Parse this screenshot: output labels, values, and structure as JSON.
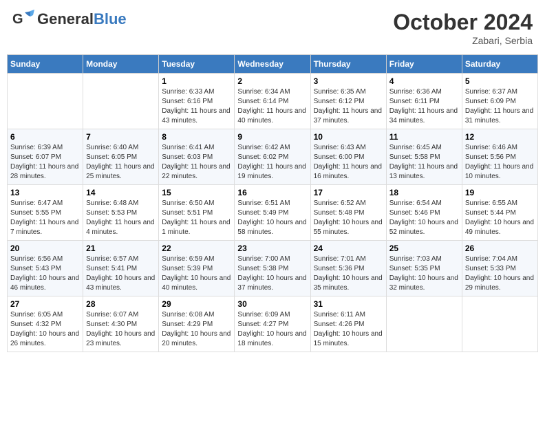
{
  "header": {
    "logo_general": "General",
    "logo_blue": "Blue",
    "month": "October 2024",
    "location": "Zabari, Serbia"
  },
  "weekdays": [
    "Sunday",
    "Monday",
    "Tuesday",
    "Wednesday",
    "Thursday",
    "Friday",
    "Saturday"
  ],
  "weeks": [
    [
      {
        "day": "",
        "info": ""
      },
      {
        "day": "",
        "info": ""
      },
      {
        "day": "1",
        "info": "Sunrise: 6:33 AM\nSunset: 6:16 PM\nDaylight: 11 hours and 43 minutes."
      },
      {
        "day": "2",
        "info": "Sunrise: 6:34 AM\nSunset: 6:14 PM\nDaylight: 11 hours and 40 minutes."
      },
      {
        "day": "3",
        "info": "Sunrise: 6:35 AM\nSunset: 6:12 PM\nDaylight: 11 hours and 37 minutes."
      },
      {
        "day": "4",
        "info": "Sunrise: 6:36 AM\nSunset: 6:11 PM\nDaylight: 11 hours and 34 minutes."
      },
      {
        "day": "5",
        "info": "Sunrise: 6:37 AM\nSunset: 6:09 PM\nDaylight: 11 hours and 31 minutes."
      }
    ],
    [
      {
        "day": "6",
        "info": "Sunrise: 6:39 AM\nSunset: 6:07 PM\nDaylight: 11 hours and 28 minutes."
      },
      {
        "day": "7",
        "info": "Sunrise: 6:40 AM\nSunset: 6:05 PM\nDaylight: 11 hours and 25 minutes."
      },
      {
        "day": "8",
        "info": "Sunrise: 6:41 AM\nSunset: 6:03 PM\nDaylight: 11 hours and 22 minutes."
      },
      {
        "day": "9",
        "info": "Sunrise: 6:42 AM\nSunset: 6:02 PM\nDaylight: 11 hours and 19 minutes."
      },
      {
        "day": "10",
        "info": "Sunrise: 6:43 AM\nSunset: 6:00 PM\nDaylight: 11 hours and 16 minutes."
      },
      {
        "day": "11",
        "info": "Sunrise: 6:45 AM\nSunset: 5:58 PM\nDaylight: 11 hours and 13 minutes."
      },
      {
        "day": "12",
        "info": "Sunrise: 6:46 AM\nSunset: 5:56 PM\nDaylight: 11 hours and 10 minutes."
      }
    ],
    [
      {
        "day": "13",
        "info": "Sunrise: 6:47 AM\nSunset: 5:55 PM\nDaylight: 11 hours and 7 minutes."
      },
      {
        "day": "14",
        "info": "Sunrise: 6:48 AM\nSunset: 5:53 PM\nDaylight: 11 hours and 4 minutes."
      },
      {
        "day": "15",
        "info": "Sunrise: 6:50 AM\nSunset: 5:51 PM\nDaylight: 11 hours and 1 minute."
      },
      {
        "day": "16",
        "info": "Sunrise: 6:51 AM\nSunset: 5:49 PM\nDaylight: 10 hours and 58 minutes."
      },
      {
        "day": "17",
        "info": "Sunrise: 6:52 AM\nSunset: 5:48 PM\nDaylight: 10 hours and 55 minutes."
      },
      {
        "day": "18",
        "info": "Sunrise: 6:54 AM\nSunset: 5:46 PM\nDaylight: 10 hours and 52 minutes."
      },
      {
        "day": "19",
        "info": "Sunrise: 6:55 AM\nSunset: 5:44 PM\nDaylight: 10 hours and 49 minutes."
      }
    ],
    [
      {
        "day": "20",
        "info": "Sunrise: 6:56 AM\nSunset: 5:43 PM\nDaylight: 10 hours and 46 minutes."
      },
      {
        "day": "21",
        "info": "Sunrise: 6:57 AM\nSunset: 5:41 PM\nDaylight: 10 hours and 43 minutes."
      },
      {
        "day": "22",
        "info": "Sunrise: 6:59 AM\nSunset: 5:39 PM\nDaylight: 10 hours and 40 minutes."
      },
      {
        "day": "23",
        "info": "Sunrise: 7:00 AM\nSunset: 5:38 PM\nDaylight: 10 hours and 37 minutes."
      },
      {
        "day": "24",
        "info": "Sunrise: 7:01 AM\nSunset: 5:36 PM\nDaylight: 10 hours and 35 minutes."
      },
      {
        "day": "25",
        "info": "Sunrise: 7:03 AM\nSunset: 5:35 PM\nDaylight: 10 hours and 32 minutes."
      },
      {
        "day": "26",
        "info": "Sunrise: 7:04 AM\nSunset: 5:33 PM\nDaylight: 10 hours and 29 minutes."
      }
    ],
    [
      {
        "day": "27",
        "info": "Sunrise: 6:05 AM\nSunset: 4:32 PM\nDaylight: 10 hours and 26 minutes."
      },
      {
        "day": "28",
        "info": "Sunrise: 6:07 AM\nSunset: 4:30 PM\nDaylight: 10 hours and 23 minutes."
      },
      {
        "day": "29",
        "info": "Sunrise: 6:08 AM\nSunset: 4:29 PM\nDaylight: 10 hours and 20 minutes."
      },
      {
        "day": "30",
        "info": "Sunrise: 6:09 AM\nSunset: 4:27 PM\nDaylight: 10 hours and 18 minutes."
      },
      {
        "day": "31",
        "info": "Sunrise: 6:11 AM\nSunset: 4:26 PM\nDaylight: 10 hours and 15 minutes."
      },
      {
        "day": "",
        "info": ""
      },
      {
        "day": "",
        "info": ""
      }
    ]
  ]
}
